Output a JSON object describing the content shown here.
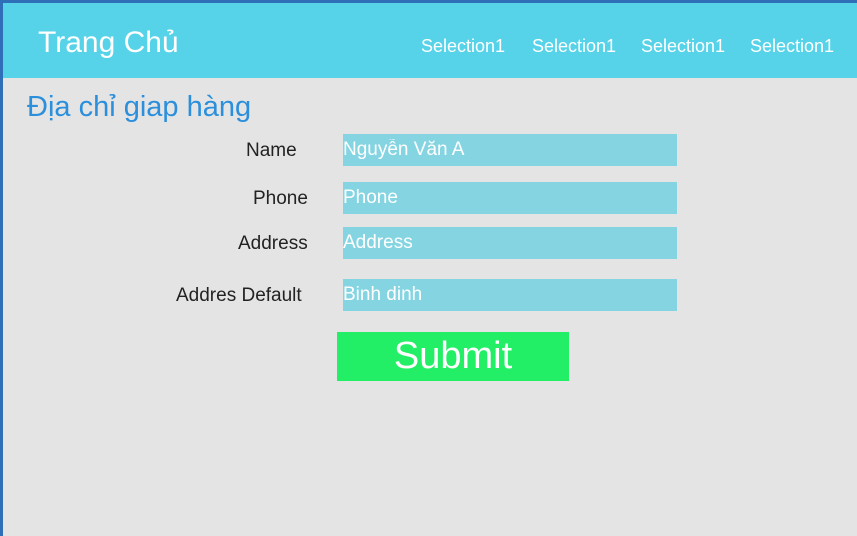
{
  "header": {
    "brand": "Trang Chủ",
    "nav": [
      {
        "label": "Selection1"
      },
      {
        "label": "Selection1"
      },
      {
        "label": "Selection1"
      },
      {
        "label": "Selection1"
      }
    ]
  },
  "page": {
    "title": "Địa chỉ giap hàng"
  },
  "form": {
    "name": {
      "label": "Name",
      "value": "Nguyễn Văn A"
    },
    "phone": {
      "label": "Phone",
      "value": "",
      "placeholder": "Phone"
    },
    "address": {
      "label": "Address",
      "value": "",
      "placeholder": "Address"
    },
    "address_default": {
      "label": "Addres Default",
      "value": "Binh dinh"
    },
    "submit_label": "Submit"
  },
  "colors": {
    "header_bg": "#56d3e8",
    "page_bg": "#e4e4e4",
    "input_bg": "#85d4e2",
    "title": "#2b8fdc",
    "submit_bg": "#22ee66",
    "frame_border": "#2f6fb8"
  }
}
